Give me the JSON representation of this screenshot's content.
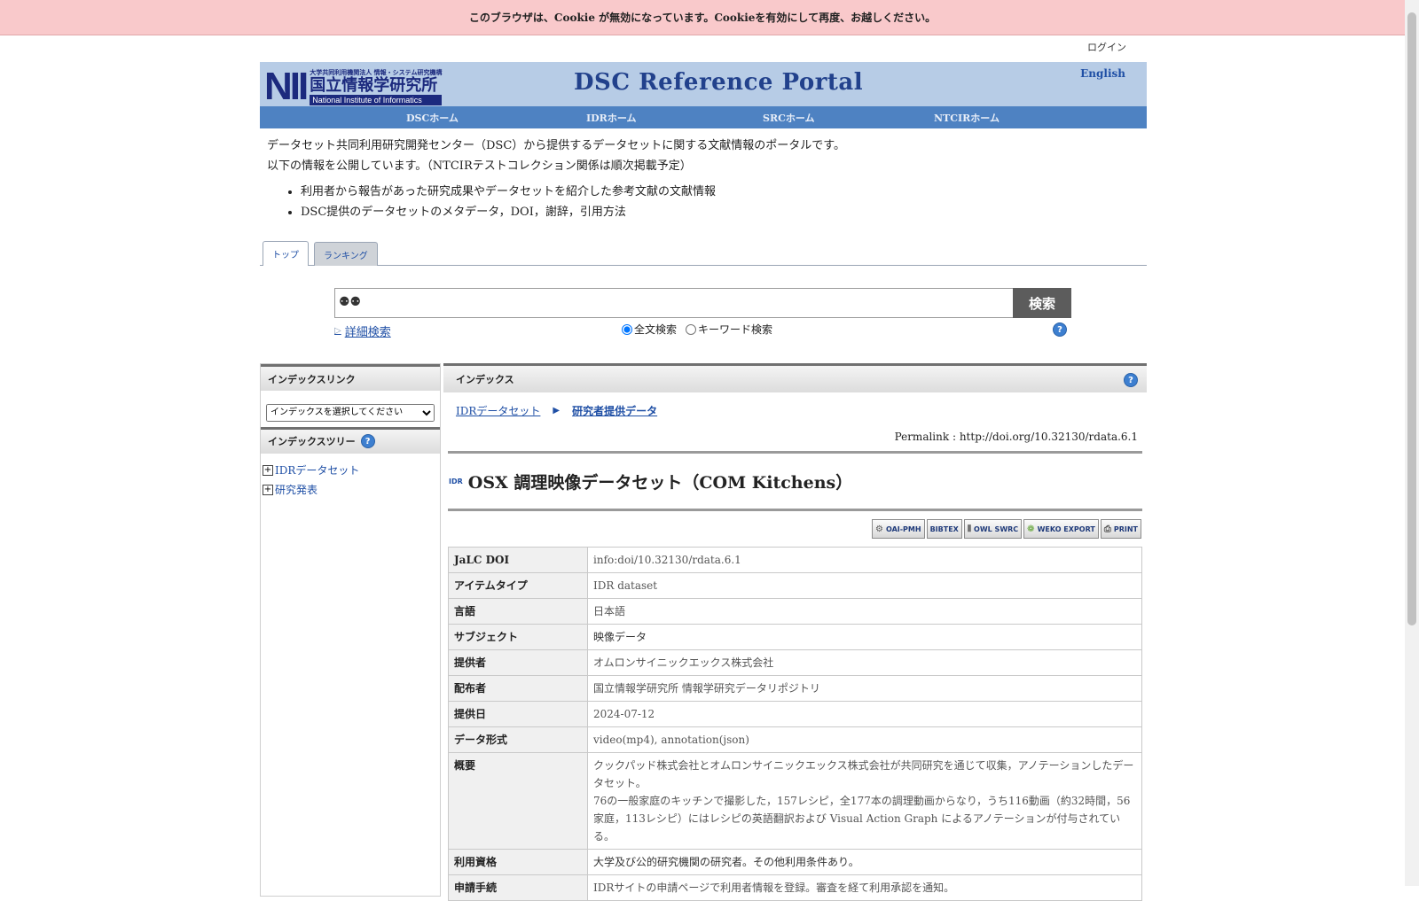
{
  "cookie_notice": "このブラウザは、Cookie が無効になっています。Cookieを有効にして再度、お越しください。",
  "login_label": "ログイン",
  "header": {
    "logo_nii": "NII",
    "logo_org": "大学共同利用機関法人 情報・システム研究機構",
    "logo_jp": "国立情報学研究所",
    "logo_en": "National Institute of Informatics",
    "portal_title": "DSC Reference Portal",
    "english_link": "English"
  },
  "nav": {
    "dsc": "DSCホーム",
    "idr": "IDRホーム",
    "src": "SRCホーム",
    "ntcir": "NTCIRホーム"
  },
  "intro": {
    "line1": "データセット共同利用研究開発センター（DSC）から提供するデータセットに関する文献情報のポータルです。",
    "line2": "以下の情報を公開しています。（NTCIRテストコレクション関係は順次掲載予定）",
    "bullets": [
      "利用者から報告があった研究成果やデータセットを紹介した参考文献の文献情報",
      "DSC提供のデータセットのメタデータ，DOI，謝辞，引用方法"
    ]
  },
  "tabs": {
    "top": "トップ",
    "ranking": "ランキング"
  },
  "search": {
    "button": "検索",
    "advanced": "詳細検索",
    "fulltext": "全文検索",
    "keyword": "キーワード検索",
    "binoculars_icon": "🔍"
  },
  "sidebar": {
    "index_link_title": "インデックスリンク",
    "select_placeholder": "インデックスを選択してください",
    "index_tree_title": "インデックスツリー",
    "tree": [
      "IDRデータセット",
      "研究発表"
    ]
  },
  "main": {
    "header": "インデックス",
    "breadcrumb": [
      "IDRデータセット",
      "研究者提供データ"
    ],
    "permalink": "Permalink : http://doi.org/10.32130/rdata.6.1",
    "idr_mark": "IDR",
    "title": "OSX 調理映像データセット（COM Kitchens）",
    "export_buttons": [
      "OAI-PMH",
      "BIBTEX",
      "OWL SWRC",
      "WEKO EXPORT",
      "PRINT"
    ],
    "rows": [
      {
        "key": "JaLC DOI",
        "value": "info:doi/10.32130/rdata.6.1"
      },
      {
        "key": "アイテムタイプ",
        "value": "IDR dataset"
      },
      {
        "key": "言語",
        "value": "日本語"
      },
      {
        "key": "サブジェクト",
        "value": "映像データ"
      },
      {
        "key": "提供者",
        "value": "オムロンサイニックエックス株式会社"
      },
      {
        "key": "配布者",
        "value": "国立情報学研究所 情報学研究データリポジトリ"
      },
      {
        "key": "提供日",
        "value": "2024-07-12"
      },
      {
        "key": "データ形式",
        "value": "video(mp4), annotation(json)"
      },
      {
        "key": "概要",
        "value": "クックパッド株式会社とオムロンサイニックエックス株式会社が共同研究を通じて収集，アノテーションしたデータセット。",
        "value2": "76の一般家庭のキッチンで撮影した，157レシピ，全177本の調理動画からなり，うち116動画（約32時間，56家庭，113レシピ）にはレシピの英語翻訳および Visual Action Graph によるアノテーションが付与されている。"
      },
      {
        "key": "利用資格",
        "value": "大学及び公的研究機関の研究者。その他利用条件あり。"
      },
      {
        "key": "申請手続",
        "value": "IDRサイトの申請ページで利用者情報を登録。審査を経て利用承認を通知。"
      }
    ]
  }
}
